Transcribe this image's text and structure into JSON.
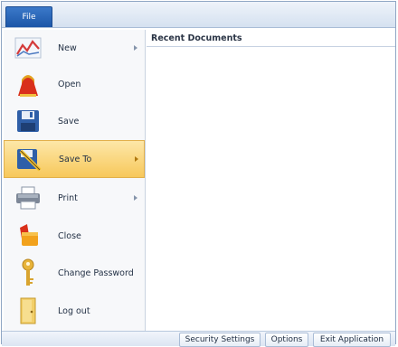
{
  "tabs": {
    "file": "File"
  },
  "menu": {
    "items": [
      {
        "label": "New",
        "icon": "chart-icon",
        "has_submenu": true
      },
      {
        "label": "Open",
        "icon": "open-folder-icon",
        "has_submenu": false
      },
      {
        "label": "Save",
        "icon": "floppy-disk-icon",
        "has_submenu": false
      },
      {
        "label": "Save To",
        "icon": "save-to-icon",
        "has_submenu": true,
        "active": true
      },
      {
        "label": "Print",
        "icon": "printer-icon",
        "has_submenu": true
      },
      {
        "label": "Close",
        "icon": "close-folder-icon",
        "has_submenu": false
      },
      {
        "label": "Change Password",
        "icon": "key-icon",
        "has_submenu": false
      },
      {
        "label": "Log out",
        "icon": "door-icon",
        "has_submenu": false
      }
    ]
  },
  "recent": {
    "header": "Recent Documents"
  },
  "footer": {
    "security_settings": "Security Settings",
    "options": "Options",
    "exit_application": "Exit Application"
  },
  "colors": {
    "file_tab": "#1c56a8",
    "active_item": "#f7c85b",
    "border": "#a9bcd6"
  }
}
